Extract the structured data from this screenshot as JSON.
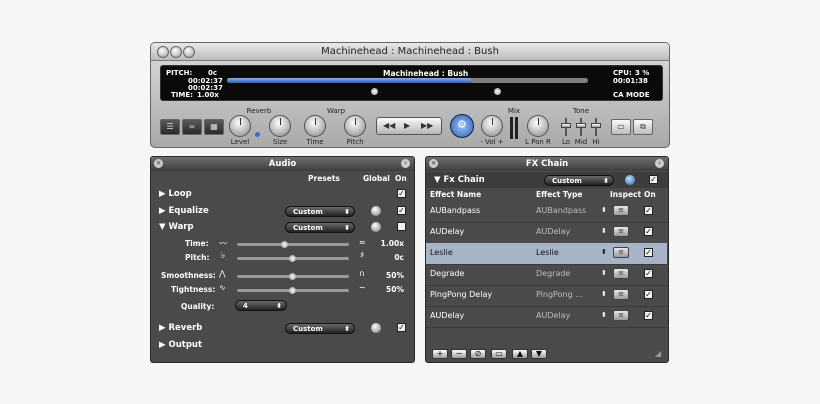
{
  "window": {
    "title": "Machinehead : Machinehead : Bush"
  },
  "display": {
    "pitch_label": "PITCH:",
    "pitch_value": "0c",
    "time1": "00:02:37",
    "time2": "00:02:37",
    "time_label": "TIME:",
    "time_value": "1.00x",
    "song": "Machinehead : Bush",
    "cpu_label": "CPU:",
    "cpu_value": "3 %",
    "elapsed": "00:01:38",
    "mode": "CA MODE",
    "progress": 0.68
  },
  "controls": {
    "reverb_group": "Reverb",
    "warp_group": "Warp",
    "mix_group": "Mix",
    "tone_group": "Tone",
    "level": "Level",
    "size": "Size",
    "time": "Time",
    "pitch": "Pitch",
    "vol": "- Vol +",
    "lpan": "L  Pan  R",
    "lo": "Lo",
    "mid": "Mid",
    "hi": "Hi",
    "rewind": "◀◀",
    "play": "▶",
    "forward": "▶▶"
  },
  "audio": {
    "title": "Audio",
    "col_presets": "Presets",
    "col_global": "Global",
    "col_on": "On",
    "loop": "Loop",
    "equalize": "Equalize",
    "equalize_preset": "Custom",
    "warp": "Warp",
    "warp_preset": "Custom",
    "time_label": "Time:",
    "time_val": "1.00x",
    "pitch_label": "Pitch:",
    "pitch_val": "0c",
    "smooth_label": "Smoothness:",
    "smooth_val": "50%",
    "tight_label": "Tightness:",
    "tight_val": "50%",
    "quality_label": "Quality:",
    "quality_val": "4",
    "reverb": "Reverb",
    "reverb_preset": "Custom",
    "output": "Output"
  },
  "fx": {
    "title": "FX Chain",
    "chain_label": "Fx Chain",
    "chain_preset": "Custom",
    "col_name": "Effect Name",
    "col_type": "Effect Type",
    "col_inspect": "Inspect",
    "col_on": "On",
    "rows": [
      {
        "name": "AUBandpass",
        "type": "AUBandpass"
      },
      {
        "name": "AUDelay",
        "type": "AUDelay"
      },
      {
        "name": "Leslie",
        "type": "Leslie"
      },
      {
        "name": "Degrade",
        "type": "Degrade"
      },
      {
        "name": "PingPong Delay",
        "type": "PingPong ..."
      },
      {
        "name": "AUDelay",
        "type": "AUDelay"
      }
    ],
    "add": "+",
    "remove": "−",
    "clear": "⊘",
    "folder": "▭",
    "up": "▲",
    "down": "▼"
  }
}
